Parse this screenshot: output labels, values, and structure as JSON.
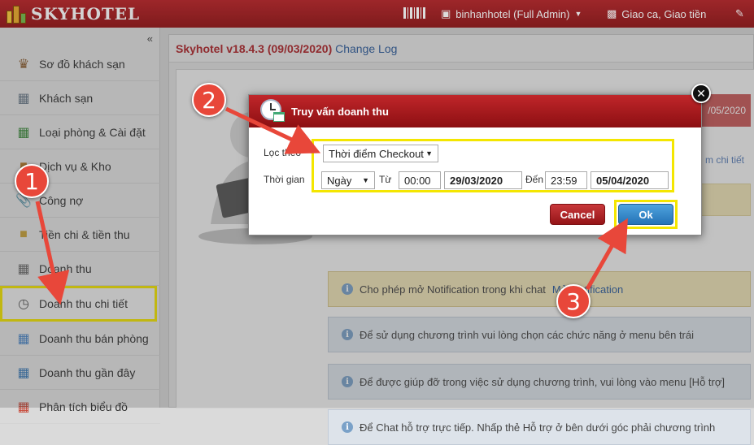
{
  "app": {
    "logo_text": "SKYHOTEL",
    "top_user": "binhanhotel (Full Admin)",
    "top_shift": "Giao ca, Giao tiền"
  },
  "sidebar": {
    "collapse_label": "«",
    "items": [
      {
        "label": "Sơ đồ khách sạn",
        "icon": "hotel-map-icon"
      },
      {
        "label": "Khách sạn",
        "icon": "building-icon"
      },
      {
        "label": "Loại phòng & Cài đặt",
        "icon": "room-type-icon"
      },
      {
        "label": "Dịch vụ & Kho",
        "icon": "service-icon"
      },
      {
        "label": "Công nợ",
        "icon": "paperclip-icon"
      },
      {
        "label": "Tiền chi & tiền thu",
        "icon": "wallet-icon"
      },
      {
        "label": "Doanh thu",
        "icon": "calculator-icon"
      },
      {
        "label": "Doanh thu chi tiết",
        "icon": "clock-calendar-icon"
      },
      {
        "label": "Doanh thu bán phòng",
        "icon": "grid-icon"
      },
      {
        "label": "Doanh thu gần đây",
        "icon": "chart-icon"
      },
      {
        "label": "Phân tích biểu đồ",
        "icon": "analytics-icon"
      }
    ]
  },
  "main": {
    "version": "Skyhotel v18.4.3 (09/03/2020)",
    "changelog": "Change Log",
    "banner_date": "/05/2020",
    "right_link": "m chi tiết",
    "notices": [
      {
        "text": "Cho phép mở Notification trong khi chat ",
        "link": "Mở Notification"
      },
      {
        "text": "Để sử dụng chương trình vui lòng chọn các chức năng ở menu bên trái",
        "link": ""
      },
      {
        "text": "Để được giúp đỡ trong việc sử dụng chương trình, vui lòng vào menu [Hỗ trợ]",
        "link": ""
      },
      {
        "text": "Để Chat hỗ trợ trực tiếp. Nhấp thẻ Hỗ trợ ở bên dưới góc phải chương trình",
        "link": ""
      }
    ]
  },
  "dialog": {
    "title": "Truy vấn doanh thu",
    "filter_label": "Lọc theo",
    "filter_value": "Thời điểm Checkout",
    "time_label": "Thời gian",
    "period_value": "Ngày",
    "from_label": "Từ",
    "from_time": "00:00",
    "from_date": "29/03/2020",
    "to_label": "Đến",
    "to_time": "23:59",
    "to_date": "05/04/2020",
    "cancel_label": "Cancel",
    "ok_label": "Ok"
  },
  "annotations": {
    "step1": "1",
    "step2": "2",
    "step3": "3"
  },
  "colors": {
    "brand_red": "#b32226",
    "highlight_yellow": "#f4e600",
    "arrow_red": "#e8473a",
    "ok_blue": "#2e80c4"
  }
}
